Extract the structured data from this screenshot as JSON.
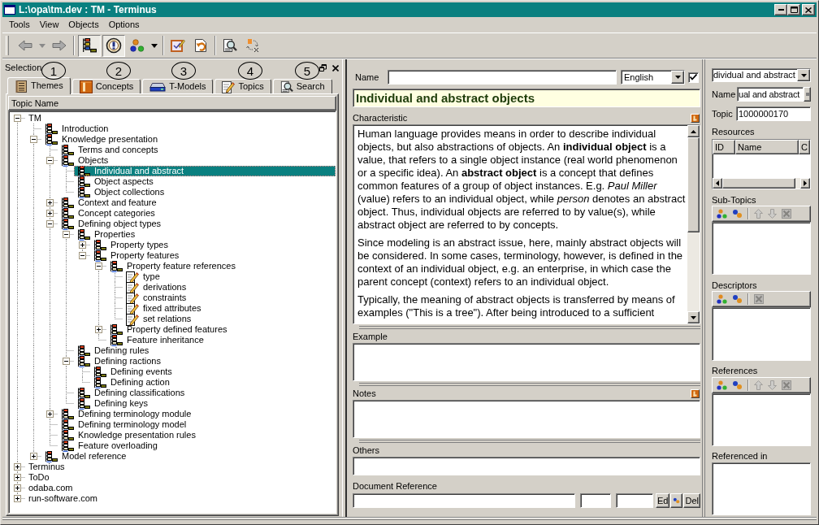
{
  "window": {
    "title": "L:\\opa\\tm.dev : TM - Terminus"
  },
  "menu": [
    {
      "label": "Tools"
    },
    {
      "label": "View"
    },
    {
      "label": "Objects"
    },
    {
      "label": "Options"
    }
  ],
  "toolbar": [
    [
      {
        "kind": "back",
        "disabled": true,
        "pressed": false
      },
      {
        "kind": "caret",
        "disabled": true,
        "pressed": false
      },
      {
        "kind": "forward",
        "disabled": true,
        "pressed": false
      }
    ],
    [
      {
        "kind": "hierarchy",
        "disabled": false,
        "pressed": true
      },
      {
        "kind": "concept",
        "disabled": false,
        "pressed": true
      },
      {
        "kind": "objects",
        "disabled": false,
        "pressed": false
      },
      {
        "kind": "caret",
        "disabled": false,
        "pressed": false
      }
    ],
    [
      {
        "kind": "edit",
        "disabled": false,
        "pressed": false
      },
      {
        "kind": "undo",
        "disabled": false,
        "pressed": false
      }
    ],
    [
      {
        "kind": "find",
        "disabled": false,
        "pressed": false
      },
      {
        "kind": "replace",
        "disabled": false,
        "pressed": false
      }
    ]
  ],
  "selection": {
    "title": "Selection",
    "callouts": [
      "1",
      "2",
      "3",
      "4",
      "5"
    ],
    "tabs": [
      {
        "label": "Themes",
        "kind": "notebook",
        "selected": true
      },
      {
        "label": "Concepts",
        "kind": "tile",
        "selected": false
      },
      {
        "label": "T-Models",
        "kind": "drive",
        "selected": false
      },
      {
        "label": "Topics",
        "kind": "pencil",
        "selected": false
      },
      {
        "label": "Search",
        "kind": "magnifier",
        "selected": false
      }
    ]
  },
  "tree": {
    "column": "Topic Name",
    "items": [
      {
        "label": "TM",
        "kind": "root",
        "selected": false,
        "expanded": true,
        "children": [
          {
            "label": "Introduction",
            "kind": "theme",
            "selected": false
          },
          {
            "label": "Knowledge presentation",
            "kind": "theme",
            "selected": false,
            "expanded": true,
            "children": [
              {
                "label": "Terms and concepts",
                "kind": "theme",
                "selected": false
              },
              {
                "label": "Objects",
                "kind": "theme",
                "selected": false,
                "expanded": true,
                "children": [
                  {
                    "label": "Individual and abstract",
                    "kind": "theme",
                    "selected": true
                  },
                  {
                    "label": "Object aspects",
                    "kind": "theme",
                    "selected": false
                  },
                  {
                    "label": "Object collections",
                    "kind": "theme",
                    "selected": false
                  }
                ]
              },
              {
                "label": "Context and feature",
                "kind": "theme",
                "selected": false,
                "expanded": false
              },
              {
                "label": "Concept categories",
                "kind": "theme",
                "selected": false,
                "expanded": false
              },
              {
                "label": "Defining object types",
                "kind": "theme",
                "selected": false,
                "expanded": true,
                "children": [
                  {
                    "label": "Properties",
                    "kind": "theme",
                    "selected": false,
                    "expanded": true,
                    "children": [
                      {
                        "label": "Property types",
                        "kind": "theme",
                        "selected": false,
                        "expanded": false
                      },
                      {
                        "label": "Property features",
                        "kind": "theme",
                        "selected": false,
                        "expanded": true,
                        "children": [
                          {
                            "label": "Property feature references",
                            "kind": "theme",
                            "selected": false,
                            "expanded": true,
                            "children": [
                              {
                                "label": "type",
                                "kind": "feature",
                                "selected": false
                              },
                              {
                                "label": "derivations",
                                "kind": "feature",
                                "selected": false
                              },
                              {
                                "label": "constraints",
                                "kind": "feature",
                                "selected": false
                              },
                              {
                                "label": "fixed attributes",
                                "kind": "feature",
                                "selected": false
                              },
                              {
                                "label": "set relations",
                                "kind": "feature",
                                "selected": false
                              }
                            ]
                          },
                          {
                            "label": "Property defined features",
                            "kind": "theme",
                            "selected": false,
                            "expanded": false
                          },
                          {
                            "label": "Feature inheritance",
                            "kind": "theme",
                            "selected": false
                          }
                        ]
                      }
                    ]
                  },
                  {
                    "label": "Defining rules",
                    "kind": "theme",
                    "selected": false
                  },
                  {
                    "label": "Defining ractions",
                    "kind": "theme",
                    "selected": false,
                    "expanded": true,
                    "children": [
                      {
                        "label": "Defining events",
                        "kind": "theme",
                        "selected": false
                      },
                      {
                        "label": "Defining action",
                        "kind": "theme",
                        "selected": false
                      }
                    ]
                  },
                  {
                    "label": "Defining classifications",
                    "kind": "theme",
                    "selected": false
                  },
                  {
                    "label": "Defining keys",
                    "kind": "theme",
                    "selected": false
                  }
                ]
              },
              {
                "label": "Defining terminology module",
                "kind": "theme",
                "selected": false,
                "expanded": false
              },
              {
                "label": "Defining terminology model",
                "kind": "theme",
                "selected": false
              },
              {
                "label": "Knowledge presentation rules",
                "kind": "theme",
                "selected": false
              },
              {
                "label": "Feature overloading",
                "kind": "theme",
                "selected": false
              }
            ]
          },
          {
            "label": "Model reference",
            "kind": "theme",
            "selected": false,
            "expanded": false
          }
        ]
      },
      {
        "label": "Terminus",
        "kind": "root",
        "selected": false,
        "expanded": false
      },
      {
        "label": "ToDo",
        "kind": "root",
        "selected": false,
        "expanded": false
      },
      {
        "label": "odaba.com",
        "kind": "root",
        "selected": false,
        "expanded": false
      },
      {
        "label": "run-software.com",
        "kind": "root",
        "selected": false,
        "expanded": false
      }
    ]
  },
  "detail": {
    "name": {
      "label": "Name"
    },
    "language": {
      "value": "English"
    },
    "active": {
      "checked": true
    },
    "heading": "Individual and abstract objects",
    "sections": [
      {
        "label": "Characteristic",
        "kind": "text",
        "language_button": true,
        "paragraphs": [
          "Human language provides means in order to describe individual objects, but also abstractions of objects. An **individual object** is a value, that refers to a single object instance (real world phenomenon or a specific idea). An **abstract object** is a concept that defines common features of a group of object instances. E.g. *Paul Miller* (value) refers to an individual object, while *person* denotes an abstract object. Thus, individual objects are referred to by value(s), while abstract object are referred to by concepts.",
          "Since modeling is an abstract issue, here, mainly abstract objects will be considered. In some cases, terminology, however, is defined in the context of an individual object, e.g. an enterprise, in which case the parent concept (context) refers to an individual object.",
          "Typically, the meaning of abstract objects is transferred by means of examples (\"This is a tree\"). After being introduced to a sufficient"
        ]
      },
      {
        "label": "Example",
        "kind": "memo",
        "language_button": false
      },
      {
        "label": "Notes",
        "kind": "memo",
        "language_button": true
      },
      {
        "label": "Others",
        "kind": "line",
        "language_button": false
      }
    ],
    "document_reference": {
      "label": "Document Reference",
      "buttons": [
        {
          "kind": "text",
          "label": "Ed"
        },
        {
          "kind": "link"
        },
        {
          "kind": "text",
          "label": "Del"
        }
      ]
    }
  },
  "topic_panel": {
    "selector": {
      "value": "dividual and abstract"
    },
    "name": {
      "label": "Name",
      "value": "ual and abstract"
    },
    "topic": {
      "label": "Topic",
      "value": "1000000170"
    },
    "resources": {
      "label": "Resources",
      "columns": [
        "ID",
        "Name",
        "C"
      ]
    },
    "lists": [
      {
        "label": "Sub-Topics",
        "tools": [
          [
            {
              "kind": "add",
              "disabled": false
            },
            {
              "kind": "link",
              "disabled": false
            }
          ],
          [
            {
              "kind": "up",
              "disabled": true
            },
            {
              "kind": "down",
              "disabled": true
            },
            {
              "kind": "delete",
              "disabled": true
            }
          ]
        ]
      },
      {
        "label": "Descriptors",
        "tools": [
          [
            {
              "kind": "add",
              "disabled": false
            },
            {
              "kind": "link",
              "disabled": false
            }
          ],
          [
            {
              "kind": "delete",
              "disabled": true
            }
          ]
        ]
      },
      {
        "label": "References",
        "tools": [
          [
            {
              "kind": "add",
              "disabled": false
            },
            {
              "kind": "link",
              "disabled": false
            }
          ],
          [
            {
              "kind": "up",
              "disabled": true
            },
            {
              "kind": "down",
              "disabled": true
            },
            {
              "kind": "delete",
              "disabled": true
            }
          ]
        ]
      },
      {
        "label": "Referenced in"
      }
    ]
  }
}
